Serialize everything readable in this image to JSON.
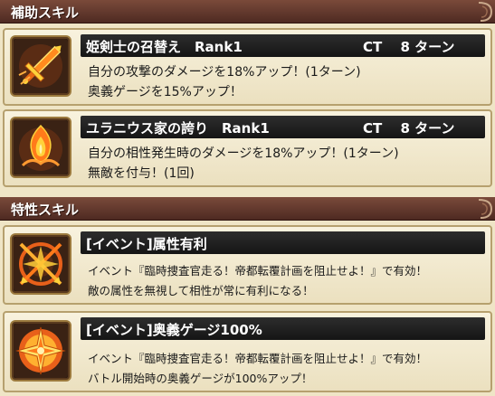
{
  "sections": {
    "support": {
      "label": "補助スキル"
    },
    "trait": {
      "label": "特性スキル"
    }
  },
  "skills": [
    {
      "title": "姫剣士の召替え　Rank1",
      "ct": "CT　 8 ターン",
      "lines": [
        "自分の攻撃のダメージを18%アップ！(1ターン)",
        "奥義ゲージを15%アップ！"
      ],
      "icon": "sword-icon"
    },
    {
      "title": "ユラニウス家の誇り　Rank1",
      "ct": "CT　 8 ターン",
      "lines": [
        "自分の相性発生時のダメージを18%アップ！(1ターン)",
        "無敵を付与！(1回)"
      ],
      "icon": "flame-crest-icon"
    }
  ],
  "traits": [
    {
      "title": "[イベント]属性有利",
      "lines": [
        "イベント『臨時捜査官走る！帝都転覆計画を阻止せよ！』で有効！",
        "敵の属性を無視して相性が常に有利になる！"
      ],
      "icon": "crossed-arrows-icon"
    },
    {
      "title": "[イベント]奥義ゲージ100%",
      "lines": [
        "イベント『臨時捜査官走る！帝都転覆計画を阻止せよ！』で有効！",
        "バトル開始時の奥義ゲージが100%アップ！"
      ],
      "icon": "starburst-icon"
    }
  ],
  "colors": {
    "header": "#5e342b",
    "icon_fire": "#ff7a1a",
    "icon_glow": "#ffd23a",
    "card_border": "#b6a06e"
  }
}
